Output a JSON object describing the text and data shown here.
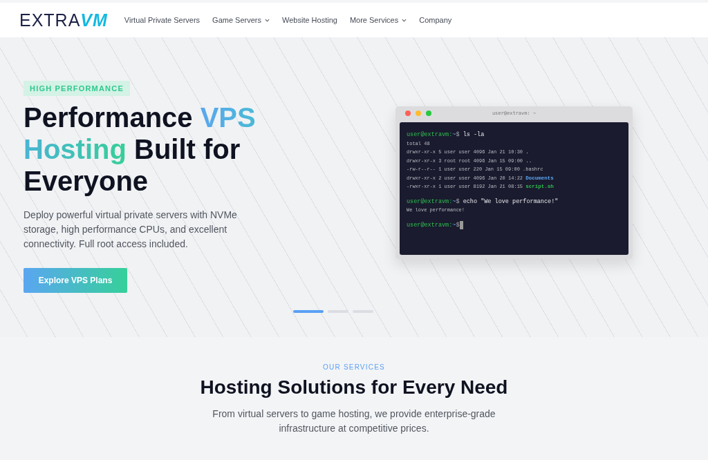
{
  "logo": {
    "text": "EXTRA",
    "mark": "VM"
  },
  "nav": [
    {
      "label": "Virtual Private Servers",
      "dropdown": false
    },
    {
      "label": "Game Servers",
      "dropdown": true
    },
    {
      "label": "Website Hosting",
      "dropdown": false
    },
    {
      "label": "More Services",
      "dropdown": true
    },
    {
      "label": "Company",
      "dropdown": false
    }
  ],
  "hero": {
    "badge": "HIGH PERFORMANCE",
    "heading": [
      {
        "text": "Performance ",
        "kind": "plain"
      },
      {
        "text": "VPS ",
        "kind": "gradient_blue"
      },
      {
        "text": "Hosting",
        "kind": "gradient_green"
      },
      {
        "text": " Built for Everyone",
        "kind": "plain"
      }
    ],
    "description": "Deploy powerful virtual private servers with NVMe storage, high performance CPUs, and excellent connectivity. Full root access included.",
    "button": "Explore VPS Plans"
  },
  "terminal": {
    "title": "user@extravm: ~",
    "lines": [
      {
        "kind": "command",
        "prompt": "user@extravm:",
        "path": "~",
        "symbol": "$",
        "text": "ls -la",
        "cursor": false
      },
      {
        "kind": "output",
        "text": "total 48"
      },
      {
        "kind": "output",
        "text": "drwxr-xr-x 5 user user 4096 Jan 21 10:30",
        "name": "."
      },
      {
        "kind": "output",
        "text": "drwxr-xr-x 3 root root 4096 Jan 15 09:00",
        "name": ".."
      },
      {
        "kind": "output",
        "text": "-rw-r--r-- 1 user user 220 Jan 15 09:00 .bashrc"
      },
      {
        "kind": "output",
        "text": "drwxr-xr-x 2 user user 4096 Jan 20 14:22",
        "name": "Documents",
        "color": "#5aa6f1"
      },
      {
        "kind": "output",
        "text": "-rwxr-xr-x 1 user user 8192 Jan 21 08:15",
        "name": "script.sh",
        "color": "#2fbf4f"
      },
      {
        "kind": "gap"
      },
      {
        "kind": "command",
        "prompt": "user@extravm:",
        "path": "~",
        "symbol": "$",
        "text": "echo \"We love performance!\"",
        "cursor": false
      },
      {
        "kind": "output",
        "text": "We love performance!"
      },
      {
        "kind": "gap"
      },
      {
        "kind": "command",
        "prompt": "user@extravm:",
        "path": "~",
        "symbol": "$",
        "cursor": true
      }
    ]
  },
  "slides": [
    {
      "selected": true
    },
    {
      "selected": false
    },
    {
      "selected": false
    }
  ],
  "services": {
    "eyebrow": "OUR SERVICES",
    "heading": "Hosting Solutions for Every Need",
    "description": "From virtual servers to game hosting, we provide enterprise-grade infrastructure at competitive prices."
  }
}
